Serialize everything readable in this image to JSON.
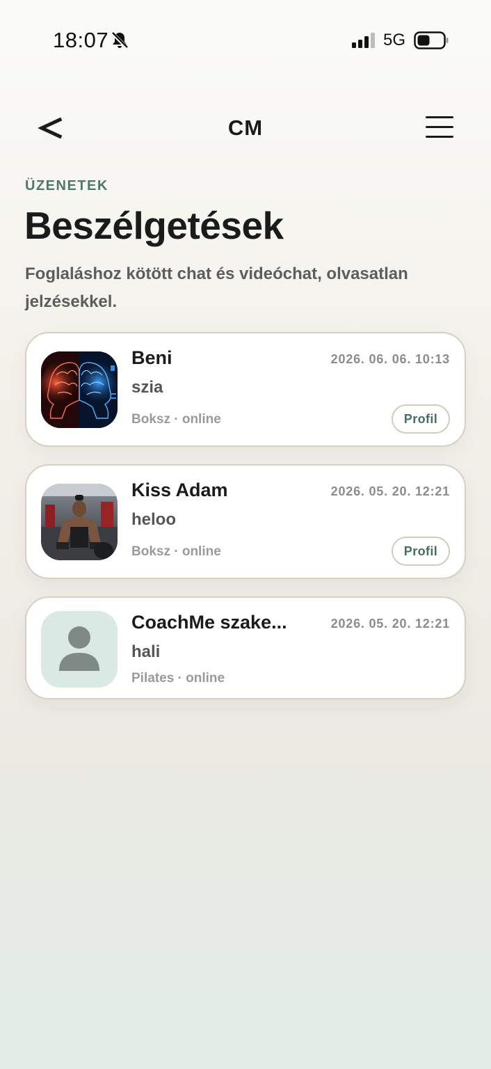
{
  "status_bar": {
    "time": "18:07",
    "network": "5G",
    "icons": [
      "bell-muted-icon",
      "signal-icon",
      "battery-icon"
    ]
  },
  "nav": {
    "logo": "CM",
    "back_icon": "chevron-left-icon",
    "menu_icon": "hamburger-menu-icon"
  },
  "header": {
    "kicker": "ÜZENETEK",
    "title": "Beszélgetések",
    "subtitle": "Foglaláshoz kötött chat és videóchat, olvasatlan jelzésekkel."
  },
  "conversations": [
    {
      "name": "Beni",
      "date": "2026. 06. 06. 10:13",
      "last_message": "szia",
      "meta": "Boksz · online",
      "profile_label": "Profil",
      "avatar": "brain-photo"
    },
    {
      "name": "Kiss Adam",
      "date": "2026. 05. 20. 12:21",
      "last_message": "heloo",
      "meta": "Boksz · online",
      "profile_label": "Profil",
      "avatar": "gym-photo"
    },
    {
      "name": "CoachMe szake...",
      "date": "2026. 05. 20. 12:21",
      "last_message": "hali",
      "meta": "Pilates · online",
      "avatar": "default-person-icon"
    }
  ],
  "colors": {
    "accent": "#4e7766",
    "card_border": "#d7cfbf",
    "muted_text": "#9a9a9a"
  }
}
